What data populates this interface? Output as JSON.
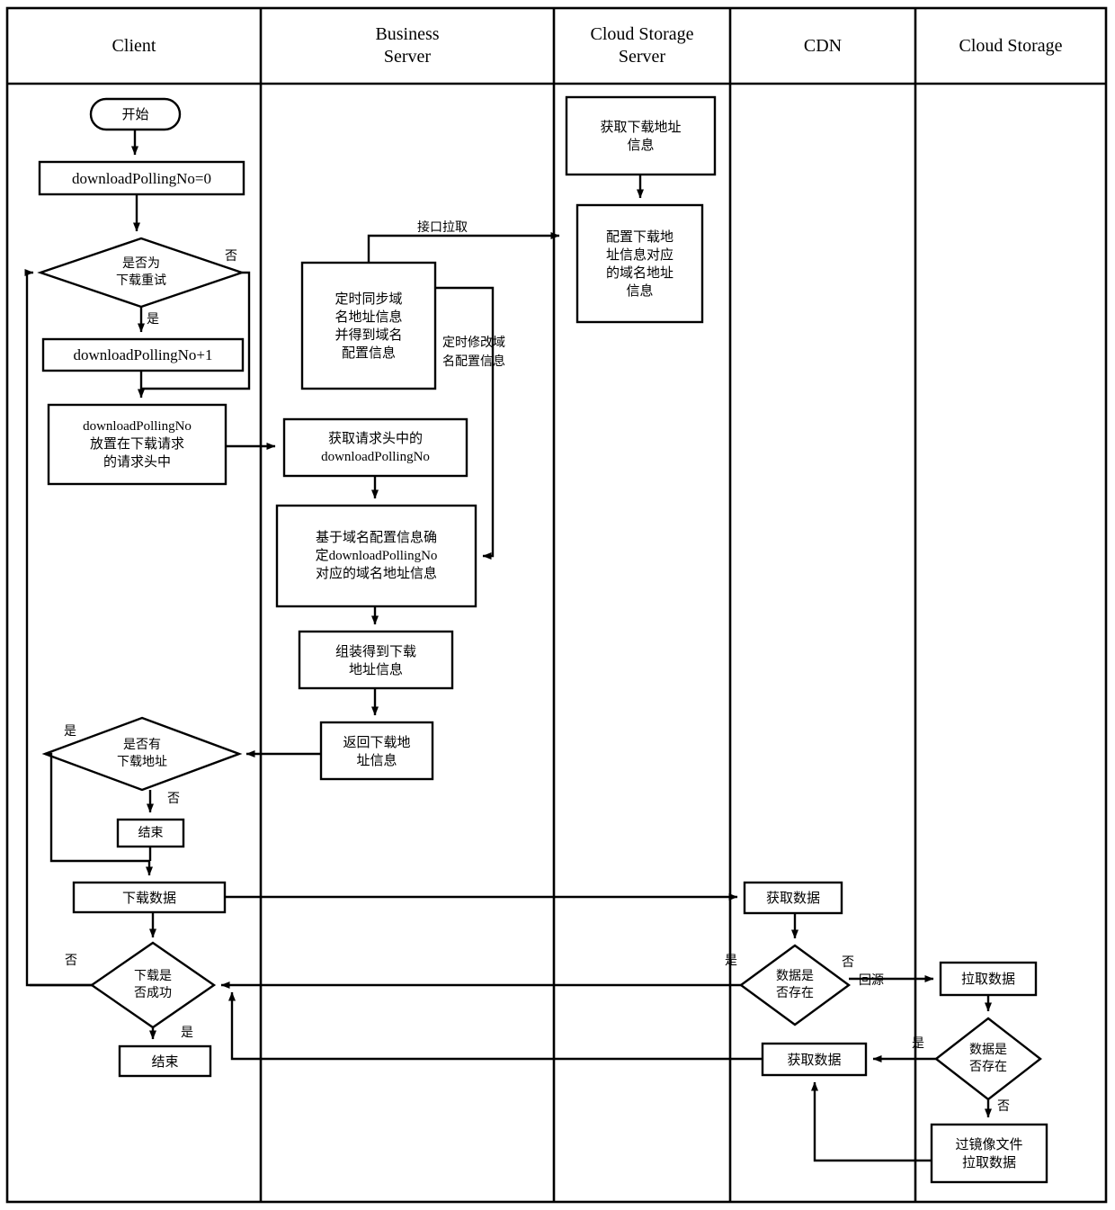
{
  "diagram": {
    "title": "Download polling flowchart (swimlane)",
    "lanes": [
      {
        "id": "client",
        "label": "Client"
      },
      {
        "id": "business_server",
        "label": "Business\nServer"
      },
      {
        "id": "cloud_storage_server",
        "label": "Cloud Storage\nServer"
      },
      {
        "id": "cdn",
        "label": "CDN"
      },
      {
        "id": "cloud_storage",
        "label": "Cloud Storage"
      }
    ],
    "nodes": {
      "start": "开始",
      "init_polling": "downloadPollingNo=0",
      "is_retry": "是否为\n下载重试",
      "incr_polling": "downloadPollingNo+1",
      "put_in_header": "downloadPollingNo\n放置在下载请求\n的请求头中",
      "get_download_addr": "获取下载地址\n信息",
      "config_domain_addr": "配置下载地\n址信息对应\n的域名地址\n信息",
      "sync_domain": "定时同步域\n名地址信息\n并得到域名\n配置信息",
      "get_header_polling": "获取请求头中的\ndownloadPollingNo",
      "determine_domain": "基于域名配置信息确\n定downloadPollingNo\n对应的域名地址信息",
      "assemble_addr": "组装得到下载\n地址信息",
      "return_addr": "返回下载地\n址信息",
      "has_download_addr": "是否有\n下载地址",
      "end_no_addr": "结束",
      "download_data": "下载数据",
      "download_success": "下载是\n否成功",
      "end_success": "结束",
      "cdn_get_data": "获取数据",
      "cdn_data_exists": "数据是\n否存在",
      "cdn_get_data2": "获取数据",
      "cs_pull_data": "拉取数据",
      "cs_data_exists": "数据是\n否存在",
      "cs_mirror_pull": "过镜像文件\n拉取数据"
    },
    "edge_labels": {
      "retry_no": "否",
      "retry_yes": "是",
      "interface_pull": "接口拉取",
      "timed_modify_domain": "定时修改域\n名配置信息",
      "has_addr_yes": "是",
      "has_addr_no": "否",
      "dl_success_no": "否",
      "dl_success_yes": "是",
      "cdn_exists_yes": "是",
      "cdn_exists_no": "否",
      "back_to_source": "回源",
      "cs_exists_yes": "是",
      "cs_exists_no": "否"
    },
    "colors": {
      "stroke": "#000000",
      "fill": "#ffffff",
      "background": "#ffffff"
    }
  }
}
